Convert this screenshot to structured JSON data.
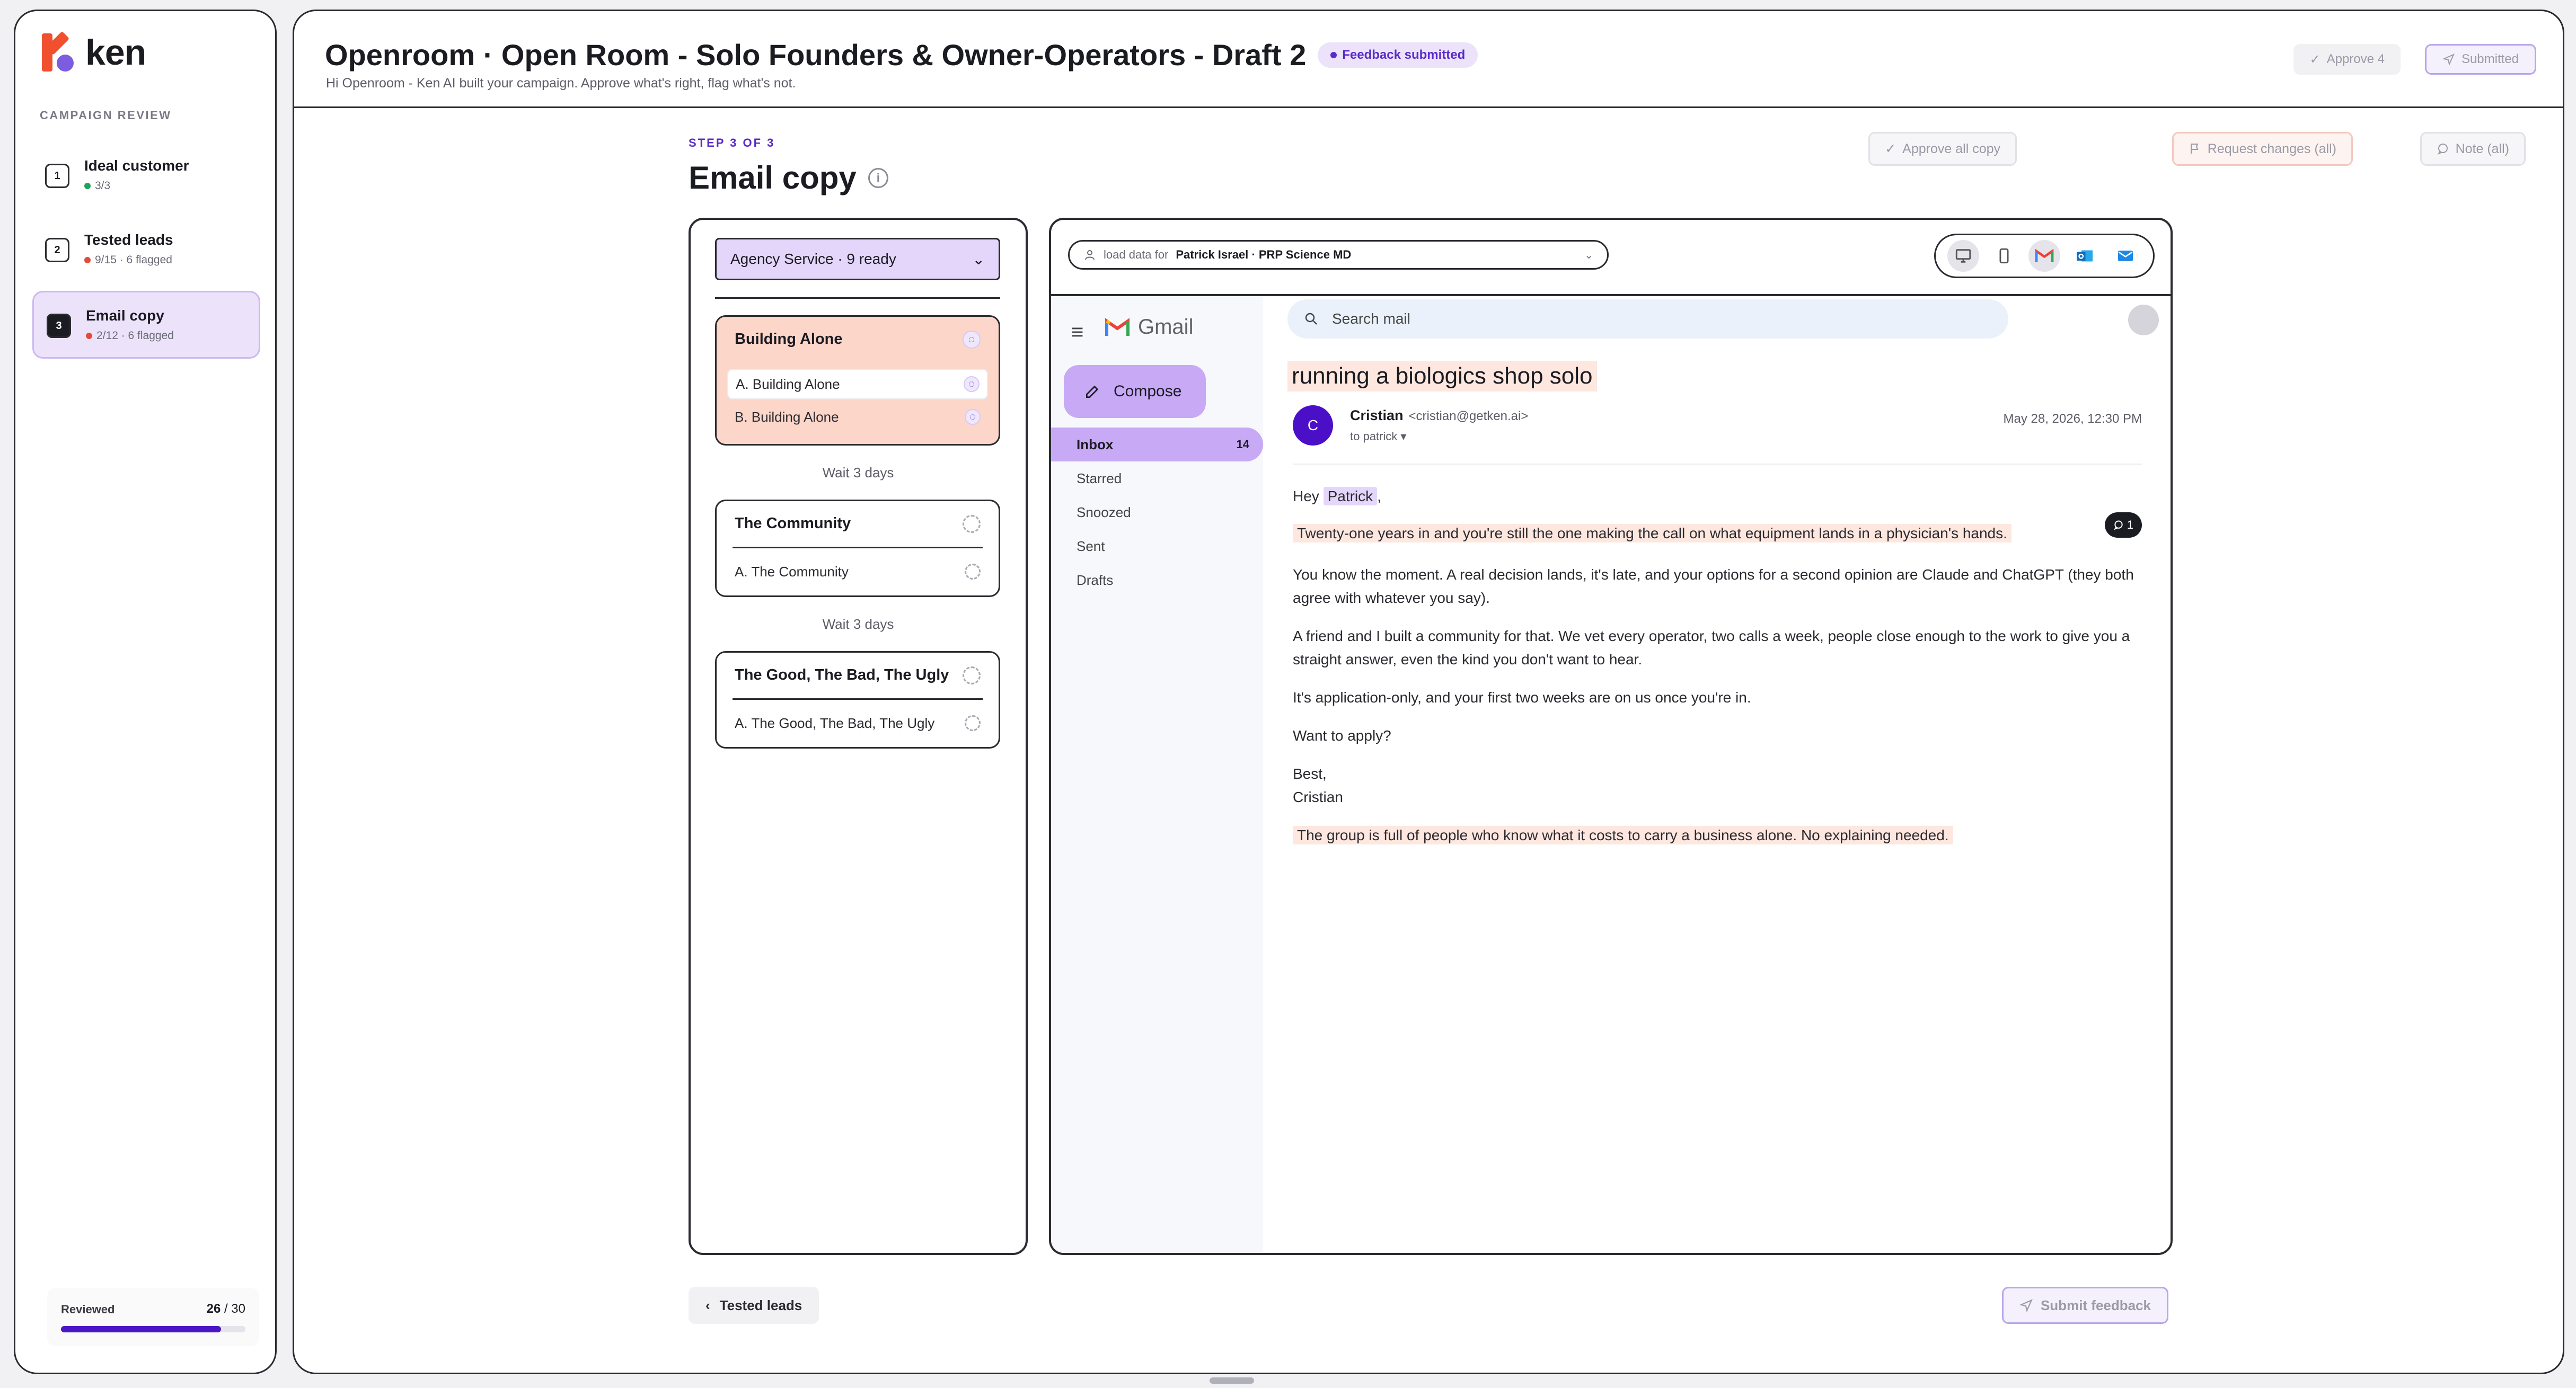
{
  "brand": {
    "name": "ken"
  },
  "sidebar": {
    "section_label": "CAMPAIGN REVIEW",
    "steps": [
      {
        "num": "1",
        "title": "Ideal customer",
        "meta": "3/3",
        "status": "green"
      },
      {
        "num": "2",
        "title": "Tested leads",
        "meta": "9/15 · 6 flagged",
        "status": "red"
      },
      {
        "num": "3",
        "title": "Email copy",
        "meta": "2/12 · 6 flagged",
        "status": "red",
        "active": true
      }
    ],
    "reviewed": {
      "label": "Reviewed",
      "done": "26",
      "total": "/ 30",
      "fraction": 0.8667
    }
  },
  "header": {
    "title": "Openroom · Open Room - Solo Founders & Owner-Operators - Draft 2",
    "badge": "Feedback submitted",
    "subtitle": "Hi Openroom - Ken AI built your campaign. Approve what's right, flag what's not.",
    "approve_label": "Approve 4",
    "submitted_label": "Submitted"
  },
  "page": {
    "step_caption": "STEP 3 OF 3",
    "title": "Email copy",
    "info_glyph": "i",
    "actions": {
      "approve_all": "Approve all copy",
      "request_changes": "Request changes (all)",
      "note_all": "Note (all)"
    }
  },
  "sequence": {
    "dropdown": "Agency Service · 9 ready",
    "cards": [
      {
        "title": "Building Alone",
        "variants": [
          "A. Building Alone",
          "B. Building Alone"
        ]
      },
      {
        "title": "The Community",
        "variants": [
          "A. The Community"
        ]
      },
      {
        "title": "The Good, The Bad, The Ugly",
        "variants": [
          "A. The Good, The Bad, The Ugly"
        ]
      }
    ],
    "waits": [
      "Wait 3 days",
      "Wait 3 days"
    ]
  },
  "preview": {
    "load_prefix": "load data for",
    "load_value": "Patrick Israel · PRP Science MD",
    "gmail": {
      "logo_text": "Gmail",
      "compose": "Compose",
      "nav": [
        {
          "label": "Inbox",
          "count": "14"
        },
        {
          "label": "Starred"
        },
        {
          "label": "Snoozed"
        },
        {
          "label": "Sent"
        },
        {
          "label": "Drafts"
        }
      ],
      "search_placeholder": "Search mail"
    },
    "email": {
      "subject": "running a biologics shop solo",
      "avatar_letter": "C",
      "sender_name": "Cristian",
      "sender_email": "<cristian@getken.ai>",
      "to": "to patrick ▾",
      "date": "May 28, 2026, 12:30 PM",
      "greeting_prefix": "Hey",
      "greeting_name": "Patrick",
      "greeting_suffix": ",",
      "p1": "Twenty-one years in and you're still the one making the call on what equipment lands in a physician's hands.",
      "comment_count": "1",
      "p2": "You know the moment. A real decision lands, it's late, and your options for a second opinion are Claude and ChatGPT (they both agree with whatever you say).",
      "p3": "A friend and I built a community for that. We vet every operator, two calls a week, people close enough to the work to give you a straight answer, even the kind you don't want to hear.",
      "p4": "It's application-only, and your first two weeks are on us once you're in.",
      "p5": "Want to apply?",
      "sign1": "Best,",
      "sign2": "Cristian",
      "ps": "The group is full of people who know what it costs to carry a business alone. No explaining needed."
    }
  },
  "footer": {
    "back_label": "Tested leads",
    "submit_label": "Submit feedback"
  },
  "colors": {
    "accent": "#5a2bc9",
    "highlight": "#fcd6c9",
    "token": "#e4d6fb",
    "progress": "#4b17c4"
  }
}
